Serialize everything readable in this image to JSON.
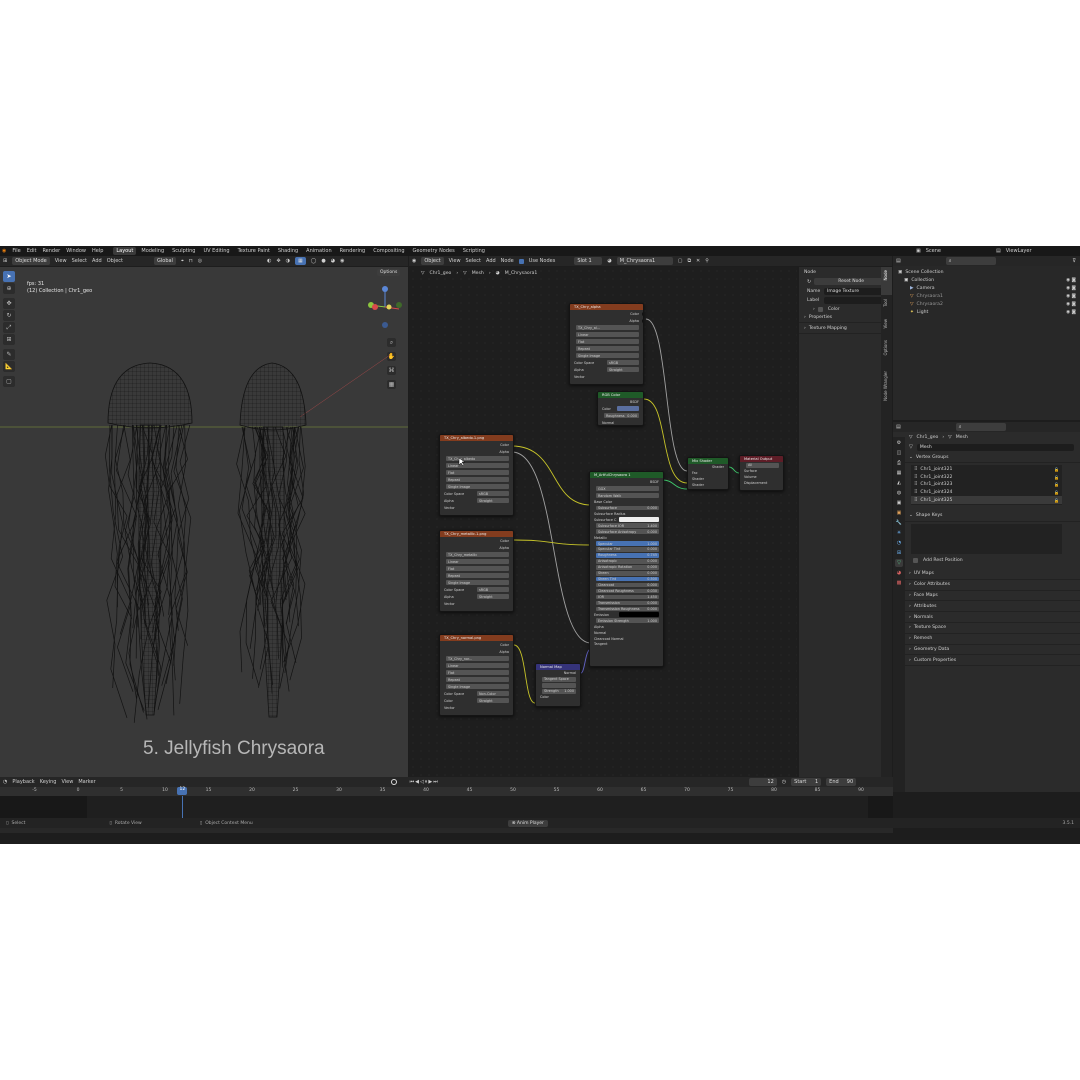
{
  "menu": {
    "file": "File",
    "edit": "Edit",
    "render": "Render",
    "window": "Window",
    "help": "Help",
    "workspaces": [
      "Layout",
      "Modeling",
      "Sculpting",
      "UV Editing",
      "Texture Paint",
      "Shading",
      "Animation",
      "Rendering",
      "Compositing",
      "Geometry Nodes",
      "Scripting"
    ],
    "scene": "Scene",
    "view_layer": "ViewLayer"
  },
  "viewport": {
    "mode": "Object Mode",
    "view": "View",
    "select": "Select",
    "add": "Add",
    "object": "Object",
    "orientation": "Global",
    "options": "Options",
    "fps": "fps: 31",
    "collection_line": "(12) Collection | Chr1_geo",
    "caption": "5. Jellyfish Chrysaora"
  },
  "node_editor": {
    "type": "Object",
    "view": "View",
    "select": "Select",
    "add": "Add",
    "node": "Node",
    "use_nodes": "Use Nodes",
    "slot": "Slot 1",
    "material": "M_Chrysaora1",
    "breadcrumb": [
      "Chr1_geo",
      "Mesh",
      "M_Chrysaora1"
    ]
  },
  "nodes": {
    "alpha": {
      "title": "TX_Chry_alpha",
      "image": "TX_Chry_al...",
      "out1": "Color",
      "out2": "Alpha",
      "interp": "Linear",
      "proj": "Flat",
      "ext": "Repeat",
      "src": "Single Image",
      "cs_label": "Color Space",
      "cs": "sRGB",
      "alpha_label": "Alpha",
      "alpha": "Straight",
      "vector": "Vector"
    },
    "albedo": {
      "title": "TX_Chry_albedo.1.png",
      "image": "TX_Chry_albedo",
      "out1": "Color",
      "out2": "Alpha",
      "interp": "Linear",
      "proj": "Flat",
      "ext": "Repeat",
      "src": "Single Image",
      "cs_label": "Color Space",
      "cs": "sRGB",
      "alpha_label": "Alpha",
      "alpha": "Straight",
      "vector": "Vector"
    },
    "metallic": {
      "title": "TX_Chry_metallic.1.png",
      "image": "TX_Chry_metallic",
      "out1": "Color",
      "out2": "Alpha",
      "interp": "Linear",
      "proj": "Flat",
      "ext": "Repeat",
      "src": "Single Image",
      "cs_label": "Color Space",
      "cs": "sRGB",
      "alpha_label": "Alpha",
      "alpha": "Straight",
      "vector": "Vector"
    },
    "normal": {
      "title": "TX_Chry_normal.png",
      "image": "TX_Chry_nor...",
      "out1": "Color",
      "out2": "Alpha",
      "interp": "Linear",
      "proj": "Flat",
      "ext": "Repeat",
      "src": "Single Image",
      "cs_label": "Color Space",
      "cs": "Non-Color",
      "alpha_label": "Color",
      "alpha": "Straight",
      "vector": "Vector"
    },
    "rgb": {
      "title": "RGB Color",
      "out": "BSDF",
      "color": "Color",
      "rough": "Roughness",
      "rough_val": "0.000",
      "normal": "Normal"
    },
    "bsdf": {
      "title": "M_ArtfulChrysaora 1",
      "out": "BSDF",
      "dist": "GGX",
      "sss": "Random Walk",
      "rows": [
        {
          "l": "Base Color",
          "v": ""
        },
        {
          "l": "Subsurface",
          "v": "0.000"
        },
        {
          "l": "Subsurface Radius",
          "v": ""
        },
        {
          "l": "Subsurface C",
          "v": ""
        },
        {
          "l": "Subsurface IOR",
          "v": "1.400"
        },
        {
          "l": "Subsurface Anisotropy",
          "v": "0.000"
        },
        {
          "l": "Metallic",
          "v": ""
        },
        {
          "l": "Specular",
          "v": "1.000"
        },
        {
          "l": "Specular Tint",
          "v": "0.000"
        },
        {
          "l": "Roughness",
          "v": "0.745"
        },
        {
          "l": "Anisotropic",
          "v": "0.000"
        },
        {
          "l": "Anisotropic Rotation",
          "v": "0.000"
        },
        {
          "l": "Sheen",
          "v": "0.000"
        },
        {
          "l": "Sheen Tint",
          "v": "0.500"
        },
        {
          "l": "Clearcoat",
          "v": "0.000"
        },
        {
          "l": "Clearcoat Roughness",
          "v": "0.030"
        },
        {
          "l": "IOR",
          "v": "1.450"
        },
        {
          "l": "Transmission",
          "v": "0.000"
        },
        {
          "l": "Transmission Roughness",
          "v": "0.000"
        },
        {
          "l": "Emission",
          "v": ""
        },
        {
          "l": "Emission Strength",
          "v": "1.000"
        },
        {
          "l": "Alpha",
          "v": ""
        },
        {
          "l": "Normal",
          "v": ""
        },
        {
          "l": "Clearcoat Normal",
          "v": ""
        },
        {
          "l": "Tangent",
          "v": ""
        }
      ]
    },
    "mix": {
      "title": "Mix Shader",
      "out": "Shader",
      "fac": "Fac",
      "s1": "Shader",
      "s2": "Shader"
    },
    "output": {
      "title": "Material Output",
      "target": "All",
      "surface": "Surface",
      "volume": "Volume",
      "disp": "Displacement"
    },
    "normal_map": {
      "title": "Normal Map",
      "out": "Normal",
      "space": "Tangent Space",
      "strength": "Strength",
      "strength_val": "1.000",
      "color": "Color"
    }
  },
  "sidebar": {
    "header": "Node",
    "reset": "Reset Node",
    "name_label": "Name",
    "name": "Image Texture",
    "label_label": "Label",
    "color": "Color",
    "properties": "Properties",
    "mapping": "Texture Mapping",
    "tabs": [
      "Node",
      "Tool",
      "View",
      "Options",
      "Node Wrangler"
    ]
  },
  "outliner": {
    "items": [
      "Scene Collection",
      "Collection",
      "Camera",
      "Chrysaora1",
      "Chrysaora2",
      "Light"
    ]
  },
  "properties": {
    "object": "Chr1_geo",
    "data": "Mesh",
    "mesh": "Mesh",
    "vertex_groups": "Vertex Groups",
    "groups": [
      "Chr1_joint321",
      "Chr1_joint322",
      "Chr1_joint323",
      "Chr1_joint324",
      "Chr1_joint325"
    ],
    "shape_keys": "Shape Keys",
    "add_rest": "Add Rest Position",
    "panels": [
      "UV Maps",
      "Color Attributes",
      "Face Maps",
      "Attributes",
      "Normals",
      "Texture Space",
      "Remesh",
      "Geometry Data",
      "Custom Properties"
    ]
  },
  "timeline": {
    "playback": "Playback",
    "keying": "Keying",
    "view": "View",
    "marker": "Marker",
    "current": "12",
    "start_label": "Start",
    "start": "1",
    "end_label": "End",
    "end": "90",
    "ticks": [
      "-5",
      "0",
      "5",
      "10",
      "15",
      "20",
      "25",
      "30",
      "35",
      "40",
      "45",
      "50",
      "55",
      "60",
      "65",
      "70",
      "75",
      "80",
      "85",
      "90"
    ]
  },
  "status": {
    "select": "Select",
    "rotate": "Rotate View",
    "context": "Object Context Menu",
    "anim": "Anim Player",
    "version": "3.5.1"
  },
  "colors": {
    "accent": "#4772b3",
    "texture_header": "#833c1e",
    "shader_header": "#1f5a28",
    "output_header": "#5e1d27",
    "link_yellow": "#c7c429",
    "link_gray": "#a1a1a1",
    "link_purple": "#6464c8"
  }
}
